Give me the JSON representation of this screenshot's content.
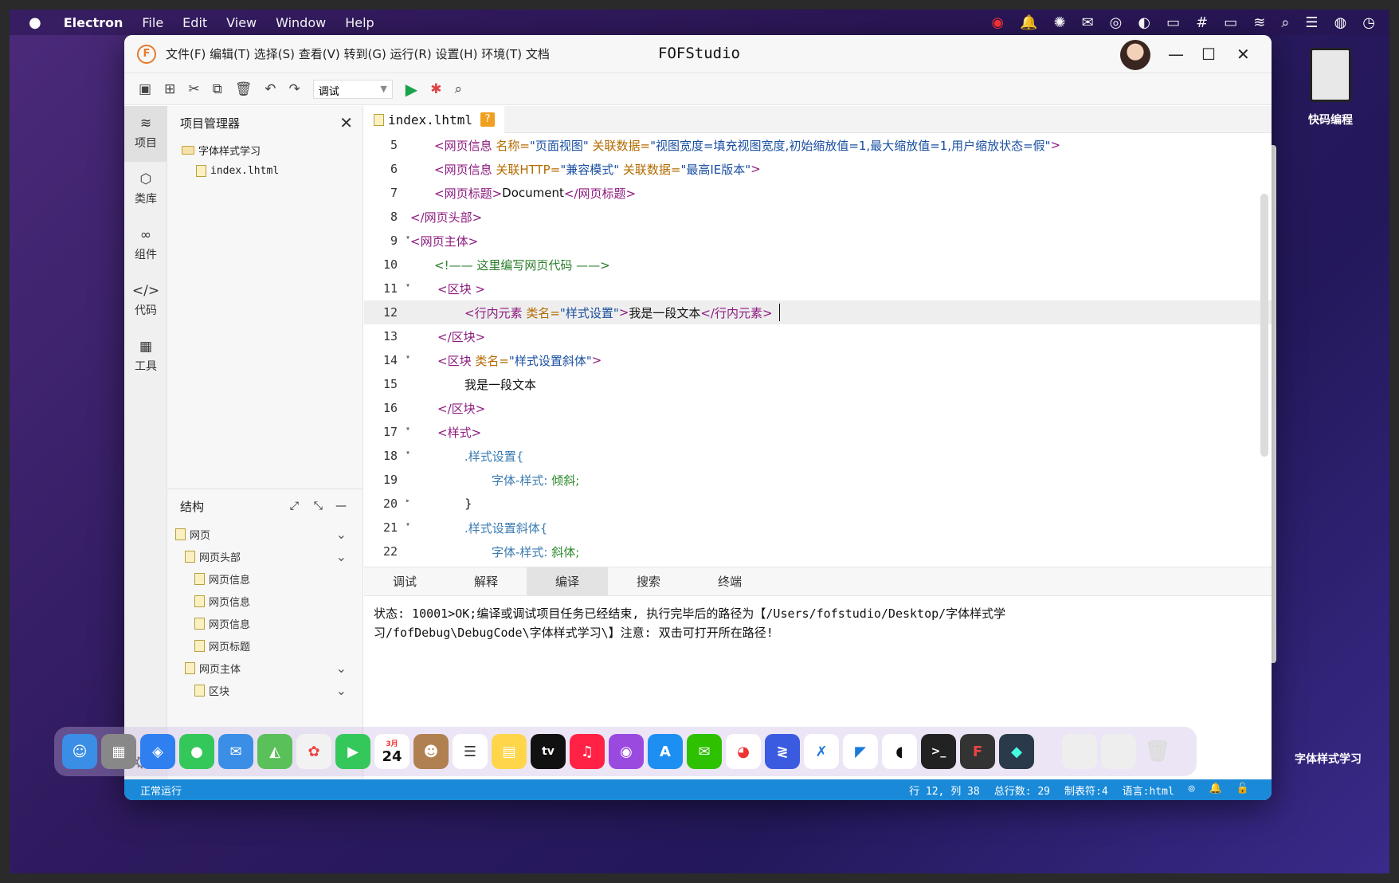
{
  "menubar": {
    "app": "Electron",
    "items": [
      "File",
      "Edit",
      "View",
      "Window",
      "Help"
    ]
  },
  "desktop_icons": {
    "kuaima": "快码编程",
    "folder": "字体样式学习"
  },
  "window": {
    "title": "FOFStudio",
    "menu": "文件(F) 编辑(T) 选择(S) 查看(V) 转到(G) 运行(R) 设置(H) 环境(T) 文档"
  },
  "toolbar": {
    "run_mode": "调试"
  },
  "activity": [
    {
      "label": "项目",
      "icon": "layers-icon"
    },
    {
      "label": "类库",
      "icon": "cube-icon"
    },
    {
      "label": "组件",
      "icon": "link-icon"
    },
    {
      "label": "代码",
      "icon": "code-icon"
    },
    {
      "label": "工具",
      "icon": "grid-icon"
    }
  ],
  "explorer": {
    "title": "项目管理器",
    "folder": "字体样式学习",
    "file": "index.lhtml"
  },
  "structure": {
    "title": "结构",
    "items": [
      "网页",
      "网页头部",
      "网页信息",
      "网页信息",
      "网页信息",
      "网页标题",
      "网页主体",
      "区块"
    ]
  },
  "editor": {
    "tab": "index.lhtml",
    "tab_badge": "?",
    "line_numbers": [
      "5",
      "6",
      "7",
      "8",
      "9",
      "10",
      "11",
      "12",
      "13",
      "14",
      "15",
      "16",
      "17",
      "18",
      "19",
      "20",
      "21",
      "22"
    ],
    "lines": {
      "l5": {
        "open": "<网页信息 ",
        "a1": "名称=",
        "v1": "\"页面视图\"",
        "a2": " 关联数据=",
        "v2": "\"视图宽度=填充视图宽度,初始缩放值=1,最大缩放值=1,用户缩放状态=假\"",
        "close": ">"
      },
      "l6": {
        "open": "<网页信息 ",
        "a1": "关联HTTP=",
        "v1": "\"兼容模式\"",
        "a2": " 关联数据=",
        "v2": "\"最高IE版本\"",
        "close": ">"
      },
      "l7": {
        "open": "<网页标题>",
        "text": "Document",
        "close": "</网页标题>"
      },
      "l8": {
        "tag": "</网页头部>"
      },
      "l9": {
        "tag": "<网页主体>"
      },
      "l10": {
        "comment": "<!—— 这里编写网页代码 ——>"
      },
      "l11": {
        "tag": "<区块 >"
      },
      "l12": {
        "open": "<行内元素 ",
        "a1": "类名=",
        "v1": "\"样式设置\"",
        "close": ">",
        "text": "我是一段文本",
        "end": "</行内元素>"
      },
      "l13": {
        "tag": "</区块>"
      },
      "l14": {
        "open": "<区块 ",
        "a1": "类名=",
        "v1": "\"样式设置斜体\"",
        "close": ">"
      },
      "l15": {
        "text": "我是一段文本"
      },
      "l16": {
        "tag": "</区块>"
      },
      "l17": {
        "tag": "<样式>"
      },
      "l18": {
        "selector": ".样式设置{"
      },
      "l19": {
        "prop": "字体-样式: ",
        "val": "倾斜;"
      },
      "l20": {
        "brace": "}"
      },
      "l21": {
        "selector": ".样式设置斜体{"
      },
      "l22": {
        "prop": "字体-样式: ",
        "val": "斜体;"
      }
    }
  },
  "panel": {
    "tabs": [
      "调试",
      "解释",
      "编译",
      "搜索",
      "终端"
    ],
    "active_tab": "编译",
    "output": "状态: 10001>OK;编译或调试项目任务已经结束, 执行完毕后的路径为【/Users/fofstudio/Desktop/字体样式学习/fofDebug\\DebugCode\\字体样式学习\\】注意: 双击可打开所在路径!"
  },
  "statusbar": {
    "left": "正常运行",
    "position": "行 12, 列 38",
    "total": "总行数: 29",
    "tab": "制表符:4",
    "lang": "语言:html"
  },
  "dock": {
    "calendar_month": "3月",
    "calendar_day": "24",
    "tv": "tv"
  }
}
